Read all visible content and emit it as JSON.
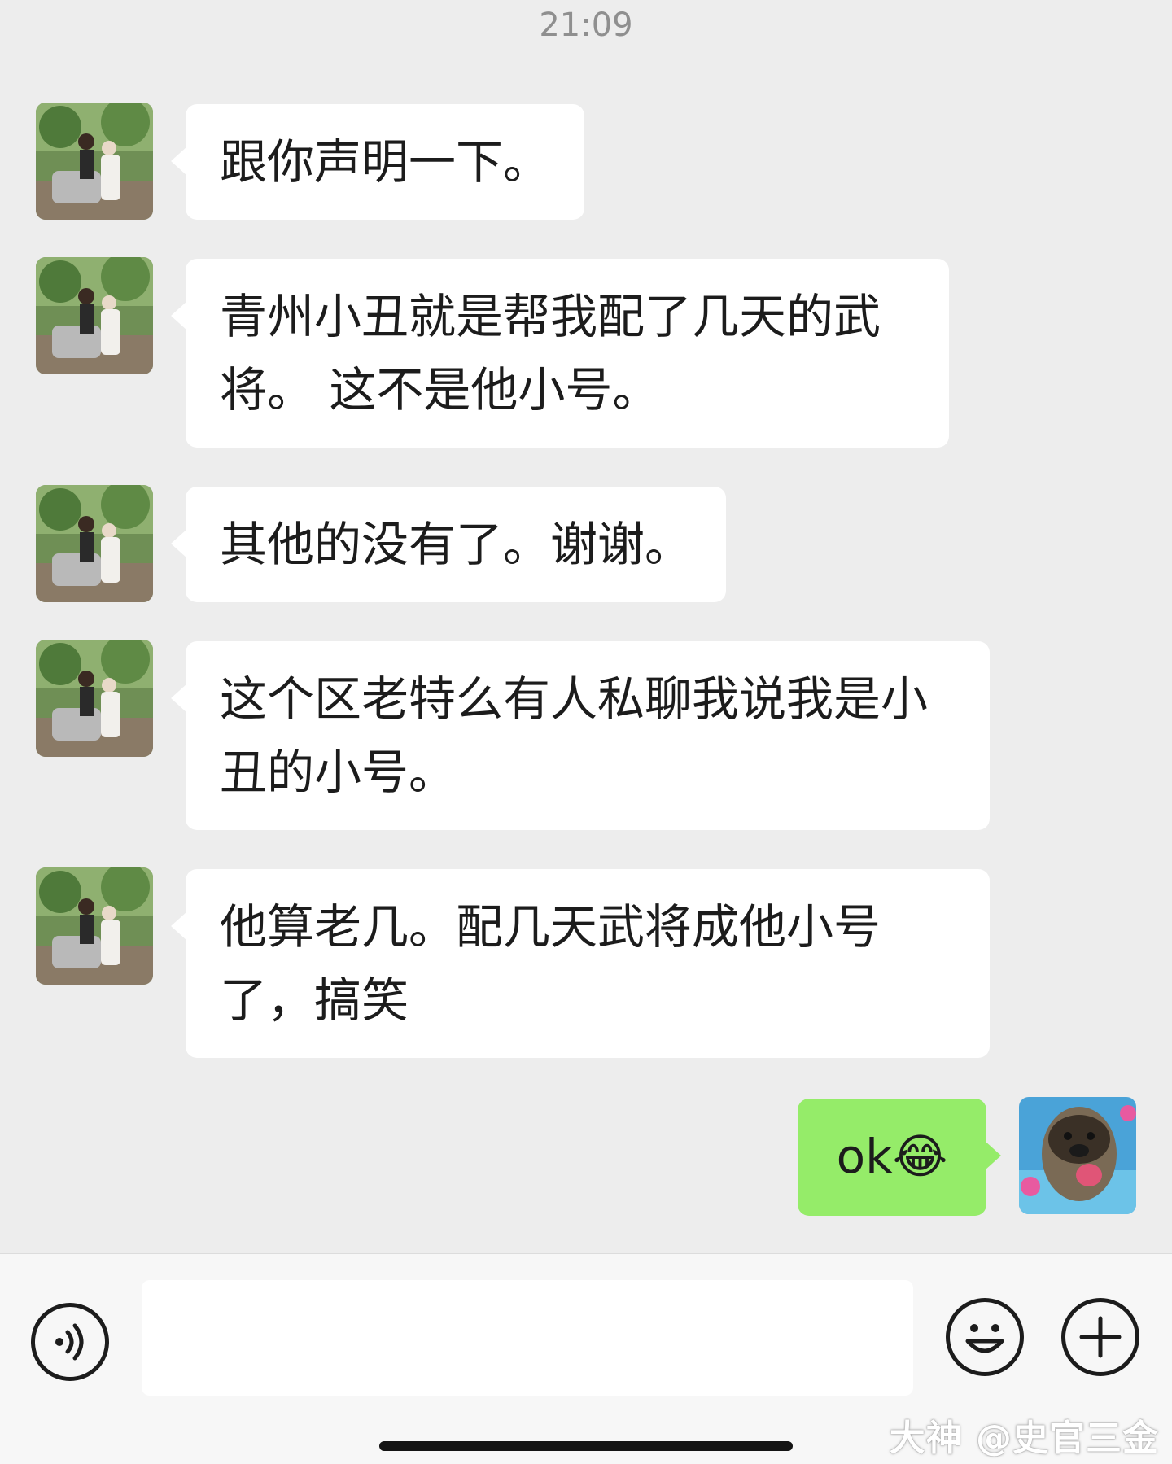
{
  "status": {
    "time": "21:09"
  },
  "messages": [
    {
      "sender": "other",
      "text": "跟你声明一下。"
    },
    {
      "sender": "other",
      "text": "青州小丑就是帮我配了几天的武将。 这不是他小号。"
    },
    {
      "sender": "other",
      "text": "其他的没有了。谢谢。"
    },
    {
      "sender": "other",
      "text": "这个区老特么有人私聊我说我是小丑的小号。"
    },
    {
      "sender": "other",
      "text": "他算老几。配几天武将成他小号了，搞笑"
    },
    {
      "sender": "self",
      "text": "ok😂"
    }
  ],
  "input": {
    "placeholder": ""
  },
  "watermark": {
    "text": "大神 @史官三金"
  },
  "colors": {
    "chat_bg": "#ededed",
    "other_bubble": "#ffffff",
    "self_bubble": "#95ec69",
    "input_bar": "#f7f7f7"
  },
  "icons": {
    "voice": "voice-icon",
    "emoji": "emoji-icon",
    "more": "plus-icon"
  }
}
